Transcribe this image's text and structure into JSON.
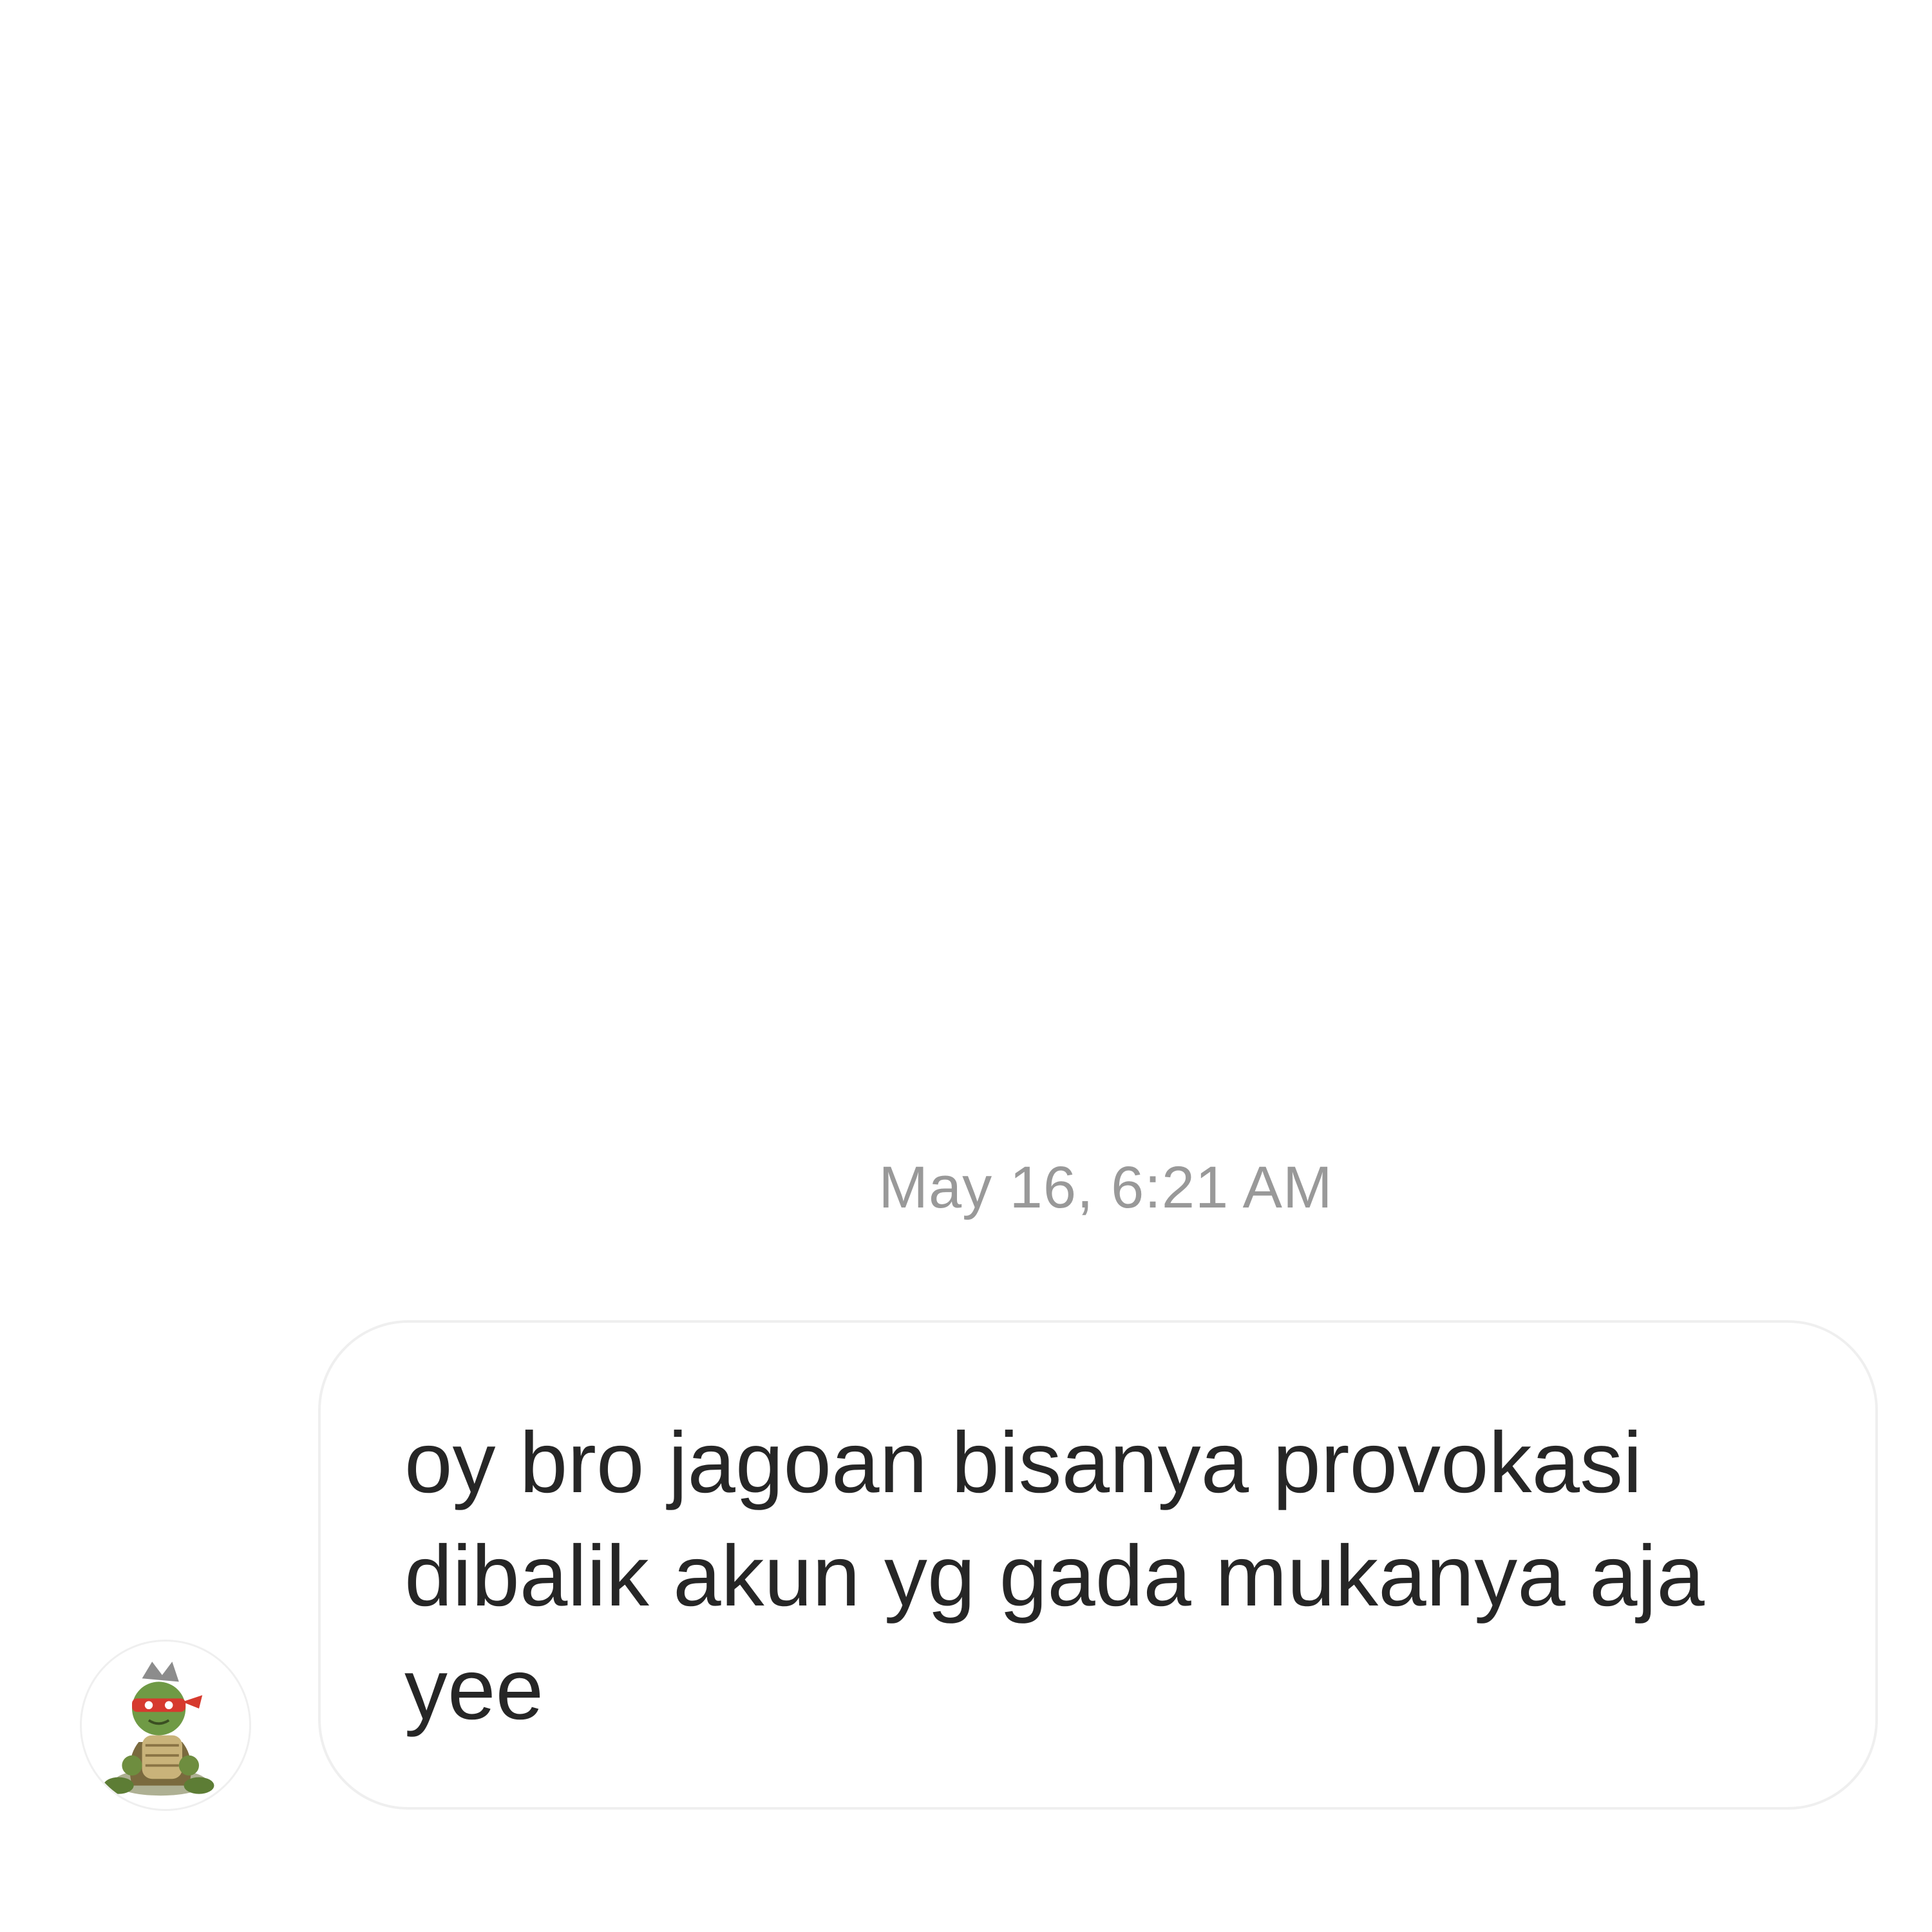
{
  "thread": {
    "timestamp": "May 16, 6:21 AM",
    "messages": [
      {
        "sender_avatar_icon": "cartoon-turtle-avatar-icon",
        "text": "oy bro jagoan bisanya provokasi\ndibalik akun yg gada mukanya aja\nyee"
      }
    ]
  },
  "colors": {
    "background": "#ffffff",
    "bubble_border": "#efefef",
    "message_text": "#262626",
    "timestamp_text": "#999999"
  }
}
